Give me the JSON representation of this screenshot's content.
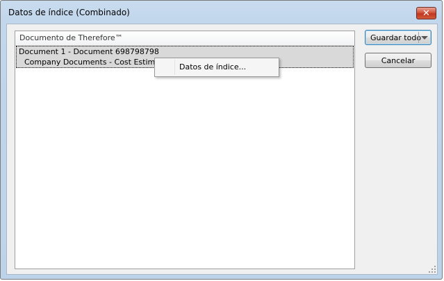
{
  "window": {
    "title": "Datos de índice (Combinado)",
    "close_glyph": "✕"
  },
  "list": {
    "header": "Documento de Therefore™",
    "rows": [
      {
        "line1": "Document 1 - Document 698798798",
        "line2": "Company Documents - Cost Estimate, 04"
      }
    ]
  },
  "buttons": {
    "save_all": "Guardar todo",
    "cancel": "Cancelar"
  },
  "context_menu": {
    "items": [
      {
        "label": "Datos de índice..."
      }
    ]
  },
  "icons": {
    "close": "close-icon",
    "dropdown": "chevron-down-icon",
    "resize": "resize-grip-icon"
  },
  "colors": {
    "selected_row": "#d9d9d9",
    "close_button": "#c1361f",
    "default_button_border": "#3c7fb1"
  }
}
